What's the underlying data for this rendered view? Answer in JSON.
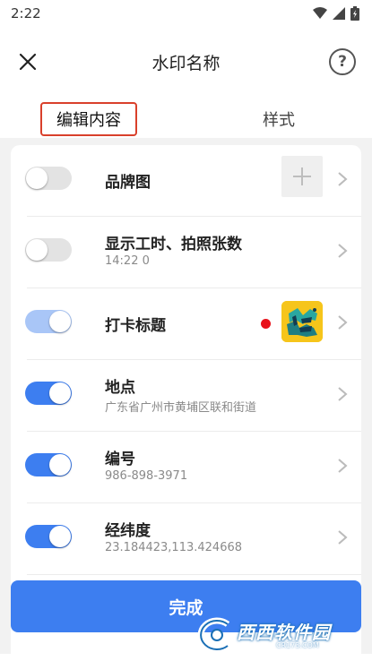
{
  "status_bar": {
    "time": "2:22"
  },
  "header": {
    "title": "水印名称",
    "help_symbol": "?"
  },
  "tabs": [
    {
      "label": "编辑内容",
      "active": true
    },
    {
      "label": "样式",
      "active": false
    }
  ],
  "rows": [
    {
      "title": "品牌图",
      "subtitle": "",
      "toggle": "off",
      "accessory": "plus-icon"
    },
    {
      "title": "显示工时、拍照张数",
      "subtitle": "14:22  0",
      "toggle": "off",
      "accessory": "none"
    },
    {
      "title": "打卡标题",
      "subtitle": "",
      "toggle": "on-disabled",
      "accessory": "checkin-logo",
      "badge": "red-dot"
    },
    {
      "title": "地点",
      "subtitle": "广东省广州市黄埔区联和街道",
      "toggle": "on",
      "accessory": "none"
    },
    {
      "title": "编号",
      "subtitle": "986-898-3971",
      "toggle": "on",
      "accessory": "none"
    },
    {
      "title": "经纬度",
      "subtitle": "23.184423,113.424668",
      "toggle": "on",
      "accessory": "none"
    }
  ],
  "done_button": {
    "label": "完成"
  },
  "watermark": {
    "text": "西西软件园",
    "sub": "CR173.COM"
  },
  "colors": {
    "accent": "#3d7ef0",
    "accent_light": "#a9c6f7",
    "tab_outline": "#d9402b",
    "red_dot": "#e8111a",
    "logo_bg": "#f6c51b"
  }
}
